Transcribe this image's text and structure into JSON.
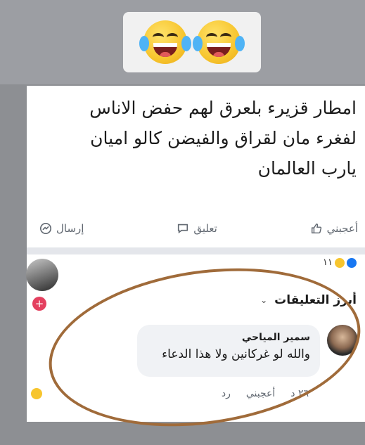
{
  "header_emojis": [
    "laughing-tears-emoji",
    "laughing-tears-emoji"
  ],
  "post": {
    "text_lines": [
      "امطار قزيرء بلعرق لهم حفض الاناس",
      "لفغرء مان لقراق والفيضن كالو اميان",
      "يارب العالمان"
    ]
  },
  "actions": {
    "like_label": "أعجبني",
    "comment_label": "تعليق",
    "send_label": "إرسال"
  },
  "reactions": {
    "count": "١١"
  },
  "top_comments_label": "أبرز التعليقات",
  "comment": {
    "name": "سمير المياحي",
    "text": "والله لو غركانين ولا هذا الدعاء",
    "time": "٢٦ د",
    "like_label": "أعجبني",
    "reply_label": "رد"
  },
  "colors": {
    "accent": "#1877f2",
    "annotation_circle": "#a06b3a",
    "plus_badge": "#e4405f"
  }
}
